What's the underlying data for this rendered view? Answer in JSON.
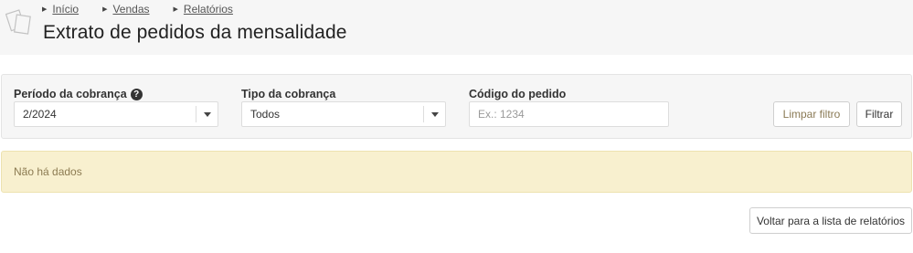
{
  "breadcrumb": {
    "items": [
      {
        "label": "Início"
      },
      {
        "label": "Vendas"
      },
      {
        "label": "Relatórios"
      }
    ]
  },
  "page": {
    "title": "Extrato de pedidos da mensalidade"
  },
  "filters": {
    "period": {
      "label": "Período da cobrança",
      "value": "2/2024",
      "help_icon": "question-circle-icon"
    },
    "type": {
      "label": "Tipo da cobrança",
      "value": "Todos"
    },
    "order_code": {
      "label": "Código do pedido",
      "placeholder": "Ex.: 1234"
    },
    "clear_button": "Limpar filtro",
    "filter_button": "Filtrar"
  },
  "alert": {
    "message": "Não há dados"
  },
  "footer": {
    "back_button": "Voltar para a lista de relatórios"
  },
  "colors": {
    "header_bg": "#f6f6f6",
    "alert_bg": "#f8f0cf",
    "alert_text": "#8c7b52"
  }
}
